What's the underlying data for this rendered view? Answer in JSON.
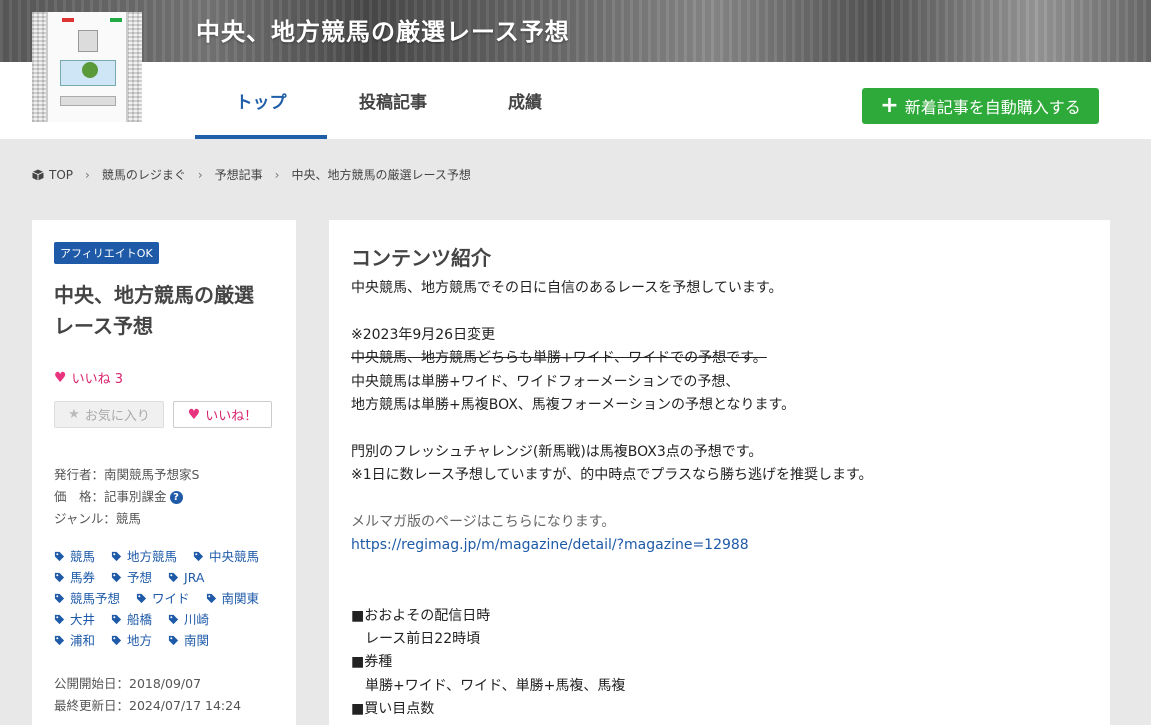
{
  "header": {
    "site_title": "中央、地方競馬の厳選レース予想",
    "nav": [
      {
        "label": "トップ",
        "active": true
      },
      {
        "label": "投稿記事",
        "active": false
      },
      {
        "label": "成績",
        "active": false
      }
    ],
    "buy_button": "新着記事を自動購入する"
  },
  "breadcrumb": [
    "TOP",
    "競馬のレジまぐ",
    "予想記事",
    "中央、地方競馬の厳選レース予想"
  ],
  "sidebar": {
    "badge": "アフィリエイトOK",
    "title_line1": "中央、地方競馬の厳選",
    "title_line2": "レース予想",
    "likes": "いいね 3",
    "fav_button": "お気に入り",
    "like_button": "いいね！",
    "publisher": "発行者：南関競馬予想家S",
    "price": "価　格：記事別課金",
    "genre": "ジャンル：競馬",
    "tags": [
      [
        "競馬",
        "地方競馬",
        "中央競馬"
      ],
      [
        "馬券",
        "予想",
        "JRA"
      ],
      [
        "競馬予想",
        "ワイド",
        "南関東"
      ],
      [
        "大井",
        "船橋",
        "川崎"
      ],
      [
        "浦和",
        "地方",
        "南関"
      ]
    ],
    "start_date": "公開開始日：2018/09/07",
    "update_date": "最終更新日：2024/07/17 14:24"
  },
  "main": {
    "heading": "コンテンツ紹介",
    "line1": "中央競馬、地方競馬でその日に自信のあるレースを予想しています。",
    "line2": "※2023年9月26日変更",
    "line3": "中央競馬、地方競馬どちらも単勝+ワイド、ワイドでの予想です。",
    "line4": "中央競馬は単勝+ワイド、ワイドフォーメーションでの予想、",
    "line5": "地方競馬は単勝+馬複BOX、馬複フォーメーションの予想となります。",
    "line6": "門別のフレッシュチャレンジ(新馬戦)は馬複BOX3点の予想です。",
    "line7": "※1日に数レース予想していますが、的中時点でプラスなら勝ち逃げを推奨します。",
    "line8": "メルマガ版のページはこちらになります。",
    "link": "https://regimag.jp/m/magazine/detail/?magazine=12988",
    "line9": "■おおよその配信日時",
    "line10": "レース前日22時頃",
    "line11": "■券種",
    "line12": "単勝+ワイド、ワイド、単勝+馬複、馬複",
    "line13": "■買い目点数"
  },
  "colors": {
    "accent_blue": "#1f5ea8",
    "buy_green": "#2eaa3a",
    "like_pink": "#d8246e"
  }
}
